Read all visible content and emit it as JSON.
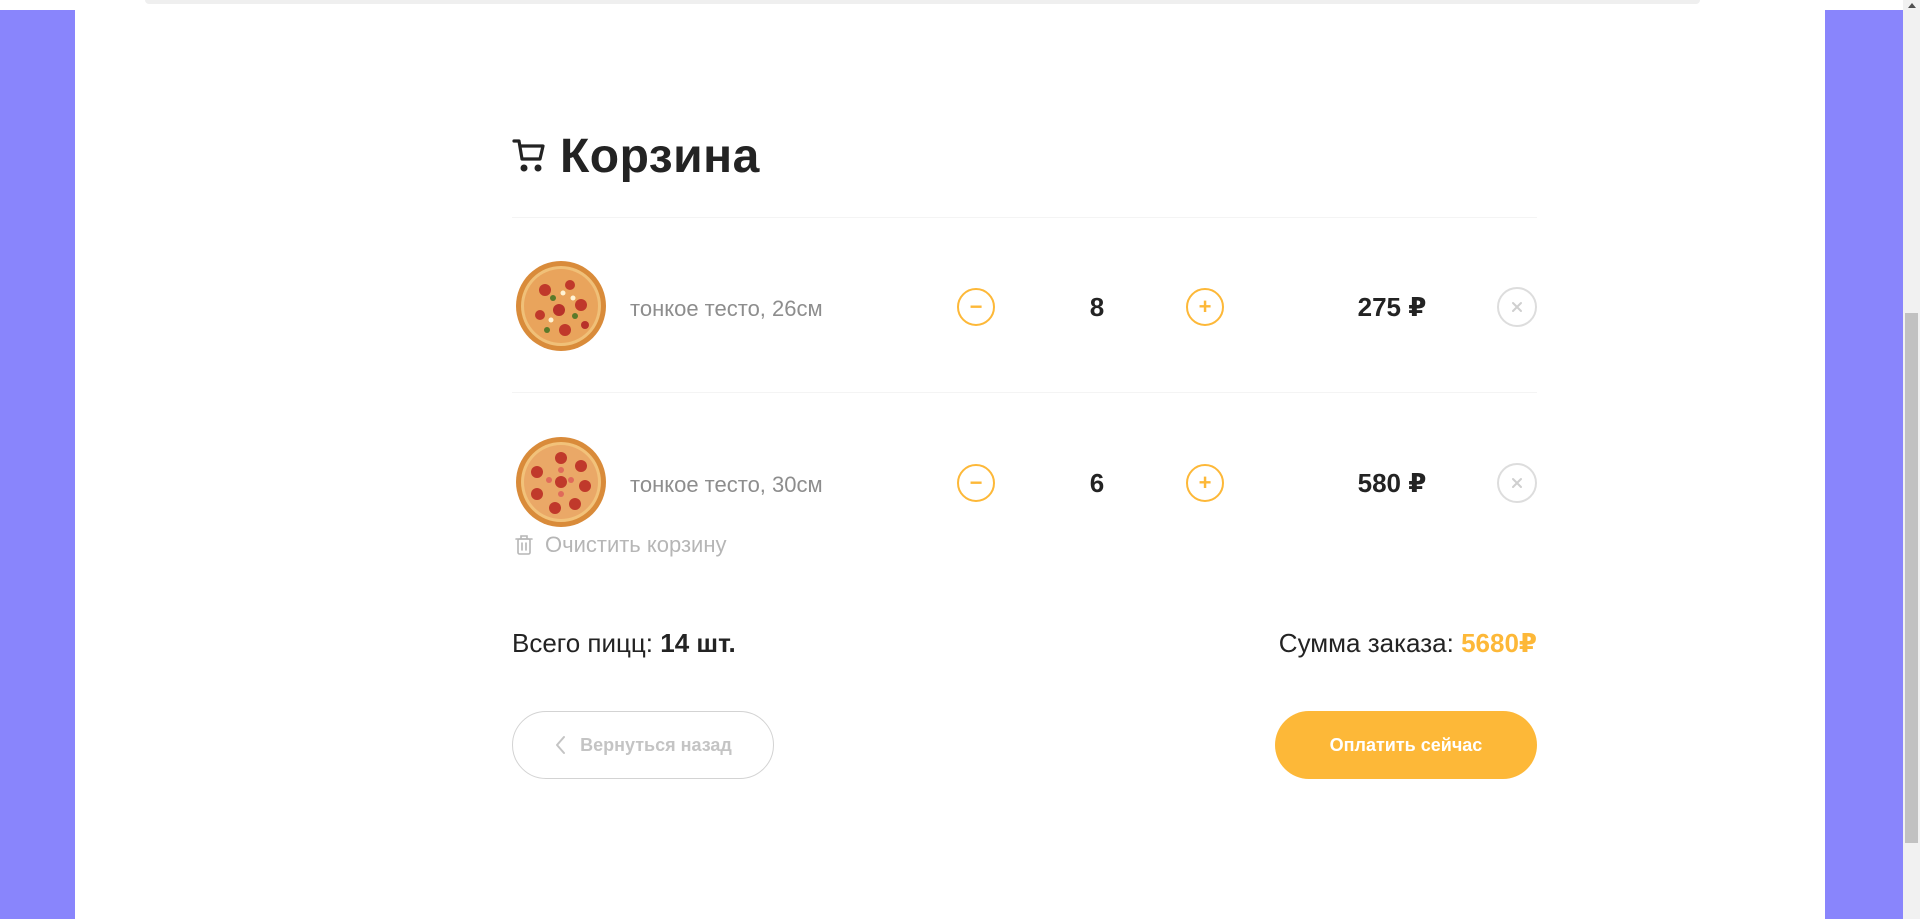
{
  "cart": {
    "title": "Корзина",
    "items": [
      {
        "description": "тонкое тесто, 26см",
        "count": "8",
        "price": "275 ₽",
        "minus": "−",
        "plus": "+"
      },
      {
        "description": "тонкое тесто, 30см",
        "count": "6",
        "price": "580 ₽",
        "minus": "−",
        "plus": "+"
      }
    ],
    "clear_label": "Очистить корзину",
    "total_pizzas_label": "Всего пицц:",
    "total_pizzas_value": "14 шт.",
    "order_sum_label": "Сумма заказа:",
    "order_sum_value": "5680₽",
    "back_label": "Вернуться назад",
    "pay_label": "Оплатить сейчас"
  },
  "colors": {
    "accent": "#fdb838",
    "background": "#8985fc",
    "text": "#232323",
    "muted": "#8d8d8d"
  },
  "icons": [
    "cart-icon",
    "trash-icon",
    "close-icon",
    "chevron-left-icon"
  ]
}
